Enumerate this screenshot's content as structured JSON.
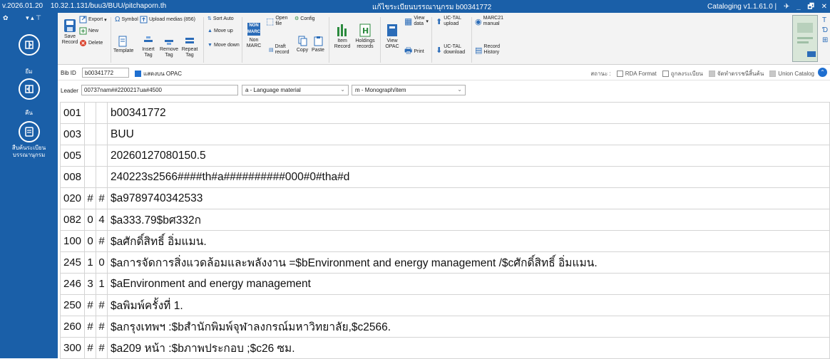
{
  "titlebar": {
    "version": "v.2026.01.20",
    "server_path": "10.32.1.131/buu3/BUU/pitchaporn.th",
    "window_title": "แก้ไขระเบียนบรรณานุกรม b00341772",
    "app_name": "Cataloging v1.1.61.0 |"
  },
  "leftnav": {
    "items": [
      {
        "label": "ยืม",
        "icon": "book-return-icon"
      },
      {
        "label": "คืน",
        "icon": "book-return-icon"
      },
      {
        "label": "สืบค้นระเบียนบรรณานุกรม",
        "label_line1": "สืบค้นระเบียน",
        "label_line2": "บรรณานุกรม",
        "icon": "catalog-search-icon"
      }
    ]
  },
  "ribbon": {
    "save_record": "Save Record",
    "save_line1": "Save",
    "save_line2": "Record",
    "export": "Export",
    "new": "New",
    "delete": "Delete",
    "symbol": "Symbol",
    "upload_medias": "Upload medias (856)",
    "template": "Template",
    "insert_tag": "Insert Tag",
    "insert_l1": "Insert",
    "insert_l2": "Tag",
    "remove_tag": "Remove Tag",
    "remove_l1": "Remove",
    "remove_l2": "Tag",
    "repeat_tag": "Repeat Tag",
    "repeat_l1": "Repeat",
    "repeat_l2": "Tag",
    "sort_auto": "Sort Auto",
    "move_up": "Move up",
    "move_down": "Move down",
    "non_marc": "Non MARC",
    "non_l1": "Non",
    "non_l2": "MARC",
    "open_file": "Open file",
    "open_l1": "Open",
    "open_l2": "file",
    "config": "Config",
    "draft_record": "Draft record",
    "draft_l1": "Draft",
    "draft_l2": "record",
    "copy": "Copy",
    "paste": "Paste",
    "item_record": "Item Record",
    "item_l1": "Item",
    "item_l2": "Record",
    "holdings_records": "Holdings records",
    "hold_l1": "Holdings",
    "hold_l2": "records",
    "view_opac": "View OPAC",
    "vo_l1": "View",
    "vo_l2": "OPAC",
    "view_data": "View data",
    "vd_l1": "View",
    "vd_l2": "data",
    "print": "Print",
    "uctal_upload": "UC-TAL upload",
    "up_l1": "UC-TAL",
    "up_l2": "upload",
    "uctal_download": "UC-TAL download",
    "dn_l1": "UC-TAL",
    "dn_l2": "download",
    "marc21_manual": "MARC21 manual",
    "mm_l1": "MARC21",
    "mm_l2": "manual",
    "record_history": "Record History",
    "rh_l1": "Record",
    "rh_l2": "History",
    "non_badge": "NON",
    "marc_badge": "MARC"
  },
  "bibrow": {
    "label": "Bib ID",
    "bib_id": "b00341772",
    "opac_label": "แสดงบน OPAC",
    "status_label": "สถานะ :",
    "rda_format": "RDA Format",
    "check_record": "ถูกลงระเบียน",
    "stock_label": "จัดทำดรรชนีสิ้นค้น",
    "union_catalog": "Union Catalog"
  },
  "leaderrow": {
    "label": "Leader",
    "leader_value": "00737nam##2200217ua#4500",
    "type_value": "a - Language material",
    "level_value": "m - Monograph/item"
  },
  "marc_fields": [
    {
      "tag": "001",
      "ind1": "",
      "ind2": "",
      "value": "b00341772"
    },
    {
      "tag": "003",
      "ind1": "",
      "ind2": "",
      "value": "BUU"
    },
    {
      "tag": "005",
      "ind1": "",
      "ind2": "",
      "value": "20260127080150.5"
    },
    {
      "tag": "008",
      "ind1": "",
      "ind2": "",
      "value": "240223s2566####th#a##########000#0#tha#d"
    },
    {
      "tag": "020",
      "ind1": "#",
      "ind2": "#",
      "value": "$a9789740342533"
    },
    {
      "tag": "082",
      "ind1": "0",
      "ind2": "4",
      "value": "$a333.79$bศ332ก"
    },
    {
      "tag": "100",
      "ind1": "0",
      "ind2": "#",
      "value": "$aศักดิ์สิทธิ์ อิ่มแมน."
    },
    {
      "tag": "245",
      "ind1": "1",
      "ind2": "0",
      "value": "$aการจัดการสิ่งแวดล้อมและพลังงาน =$bEnvironment and energy management /$cศักดิ์สิทธิ์ อิ่มแมน."
    },
    {
      "tag": "246",
      "ind1": "3",
      "ind2": "1",
      "value": "$aEnvironment and energy management"
    },
    {
      "tag": "250",
      "ind1": "#",
      "ind2": "#",
      "value": "$aพิมพ์ครั้งที่ 1."
    },
    {
      "tag": "260",
      "ind1": "#",
      "ind2": "#",
      "value": "$aกรุงเทพฯ :$bสำนักพิมพ์จุฬาลงกรณ์มหาวิทยาลัย,$c2566."
    },
    {
      "tag": "300",
      "ind1": "#",
      "ind2": "#",
      "value": "$a209 หน้า :$bภาพประกอบ ;$c26 ซม."
    }
  ],
  "colors": {
    "brand_blue": "#1a5fa8",
    "accent_blue": "#1f6fd0",
    "ribbon_bg": "#f3f3f3"
  }
}
